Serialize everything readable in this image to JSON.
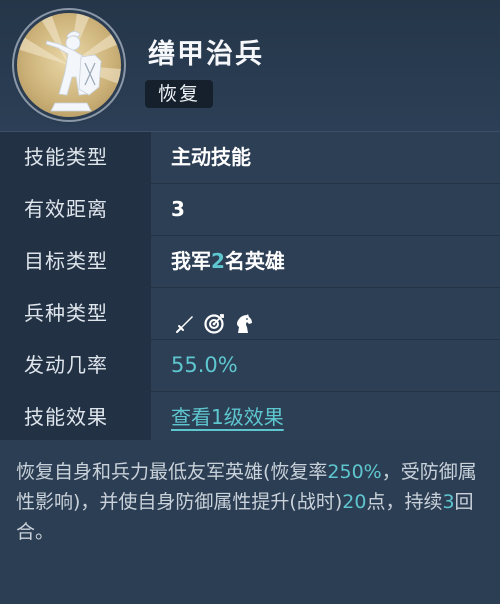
{
  "header": {
    "skill_name": "缮甲治兵",
    "type_badge": "恢复",
    "emblem_icon": "soldier-statue-icon"
  },
  "rows": {
    "skill_type": {
      "label": "技能类型",
      "value": "主动技能"
    },
    "range": {
      "label": "有效距离",
      "value": "3"
    },
    "target": {
      "label": "目标类型",
      "prefix": "我军",
      "count": "2",
      "suffix": "名英雄"
    },
    "troop_type": {
      "label": "兵种类型",
      "icons": [
        "sword-icon",
        "bow-target-icon",
        "horse-icon"
      ]
    },
    "trigger_rate": {
      "label": "发动几率",
      "value": "55.0%"
    },
    "effect": {
      "label": "技能效果",
      "link": "查看1级效果"
    }
  },
  "description": {
    "p1": "恢复自身和兵力最低友军英雄(恢复率",
    "rate": "250%",
    "p2": "，受防御属性影响)，并使自身防御属性提升(战时)",
    "points": "20",
    "p3": "点，持续",
    "turns": "3",
    "p4": "回合。"
  },
  "colors": {
    "accent": "#5ec6cf",
    "label_bg": "#223144",
    "value_bg": "#2d3f55"
  }
}
